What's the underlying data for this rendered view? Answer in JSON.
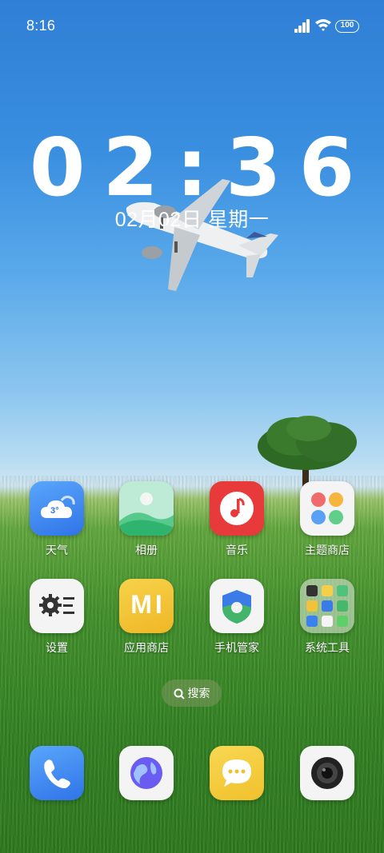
{
  "status_bar": {
    "time": "8:16",
    "battery": "100"
  },
  "lock_clock": {
    "time": "02:36",
    "date": "02月02日  星期一"
  },
  "home_apps": [
    {
      "label": "天气",
      "icon": "weather-icon",
      "badge": "3°"
    },
    {
      "label": "相册",
      "icon": "gallery-icon"
    },
    {
      "label": "音乐",
      "icon": "music-icon"
    },
    {
      "label": "主题商店",
      "icon": "theme-store-icon"
    },
    {
      "label": "设置",
      "icon": "settings-icon"
    },
    {
      "label": "应用商店",
      "icon": "app-store-icon",
      "badge": "MI"
    },
    {
      "label": "手机管家",
      "icon": "security-icon"
    },
    {
      "label": "系统工具",
      "icon": "folder-icon"
    }
  ],
  "search": {
    "label": "搜索"
  },
  "dock": [
    {
      "icon": "phone-icon"
    },
    {
      "icon": "browser-icon"
    },
    {
      "icon": "messages-icon"
    },
    {
      "icon": "camera-icon"
    }
  ],
  "colors": {
    "music_red": "#e83a3a",
    "weather_blue": "#3f8df5",
    "appstore_yellow": "#f2c234",
    "messages_yellow": "#f5cf3b"
  }
}
